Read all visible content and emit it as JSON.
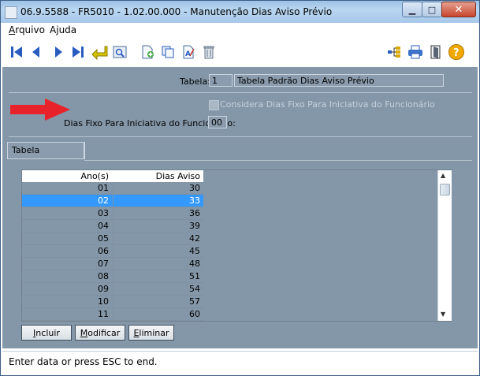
{
  "window": {
    "title": "06.9.5588 - FR5010 - 1.02.00.000 - Manutenção Dias Aviso Prévio"
  },
  "menu": {
    "arquivo": "Arquivo",
    "ajuda": "Ajuda"
  },
  "form": {
    "tabela_label": "Tabela:",
    "tabela_code": "1",
    "tabela_desc": "Tabela Padrão Dias Aviso Prévio",
    "considera_label": "Considera Dias Fixo Para Iniciativa do Funcionário",
    "dias_fixo_label": "Dias Fixo Para Iniciativa do Funcionário:",
    "dias_fixo_value": "00"
  },
  "tab": {
    "label": "Tabela"
  },
  "grid": {
    "headers": {
      "ano": "Ano(s)",
      "dias": "Dias Aviso"
    },
    "rows": [
      {
        "ano": "01",
        "dias": "30"
      },
      {
        "ano": "02",
        "dias": "33"
      },
      {
        "ano": "03",
        "dias": "36"
      },
      {
        "ano": "04",
        "dias": "39"
      },
      {
        "ano": "05",
        "dias": "42"
      },
      {
        "ano": "06",
        "dias": "45"
      },
      {
        "ano": "07",
        "dias": "48"
      },
      {
        "ano": "08",
        "dias": "51"
      },
      {
        "ano": "09",
        "dias": "54"
      },
      {
        "ano": "10",
        "dias": "57"
      },
      {
        "ano": "11",
        "dias": "60"
      }
    ]
  },
  "buttons": {
    "incluir": "Incluir",
    "modificar": "Modificar",
    "eliminar": "Eliminar"
  },
  "status": {
    "text": "Enter data or press ESC to end."
  },
  "colors": {
    "panel": "#8497a8",
    "selected_row": "#3399ff",
    "arrow": "#e8222a",
    "nav_icons": "#2a5bbf"
  },
  "icons": [
    "first-record-icon",
    "prev-record-icon",
    "next-record-icon",
    "last-record-icon",
    "goto-icon",
    "search-icon",
    "add-icon",
    "copy-icon",
    "edit-icon",
    "delete-icon",
    "tree-icon",
    "print-icon",
    "exit-icon",
    "help-icon"
  ]
}
